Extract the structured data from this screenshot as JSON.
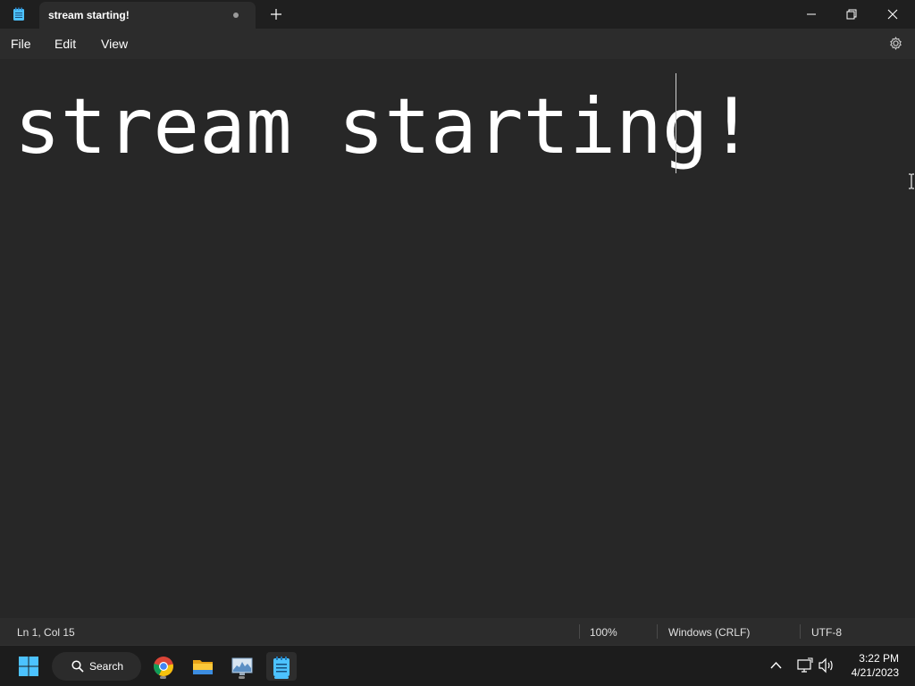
{
  "window": {
    "tab_title": "stream starting!"
  },
  "menu": {
    "file": "File",
    "edit": "Edit",
    "view": "View"
  },
  "editor": {
    "content": "stream starting!"
  },
  "status": {
    "position": "Ln 1, Col 15",
    "zoom": "100%",
    "line_ending": "Windows (CRLF)",
    "encoding": "UTF-8"
  },
  "taskbar": {
    "search_label": "Search",
    "time": "3:22 PM",
    "date": "4/21/2023"
  },
  "colors": {
    "background": "#272727",
    "chrome": "#2c2c2c",
    "titlebar": "#1f1f1f",
    "taskbar": "#1c1c1c",
    "accent": "#4cc2ff"
  },
  "icons": {
    "app": "notepad-icon",
    "new_tab": "plus-icon",
    "minimize": "minimize-icon",
    "restore": "restore-icon",
    "close": "close-icon",
    "settings": "gear-icon",
    "start": "windows-logo-icon",
    "search": "search-icon",
    "chrome": "chrome-icon",
    "explorer": "folder-icon",
    "monitor": "resource-monitor-icon",
    "notepad": "notepad-icon",
    "tray_overflow": "chevron-up-icon",
    "network": "network-icon",
    "volume": "volume-icon"
  }
}
